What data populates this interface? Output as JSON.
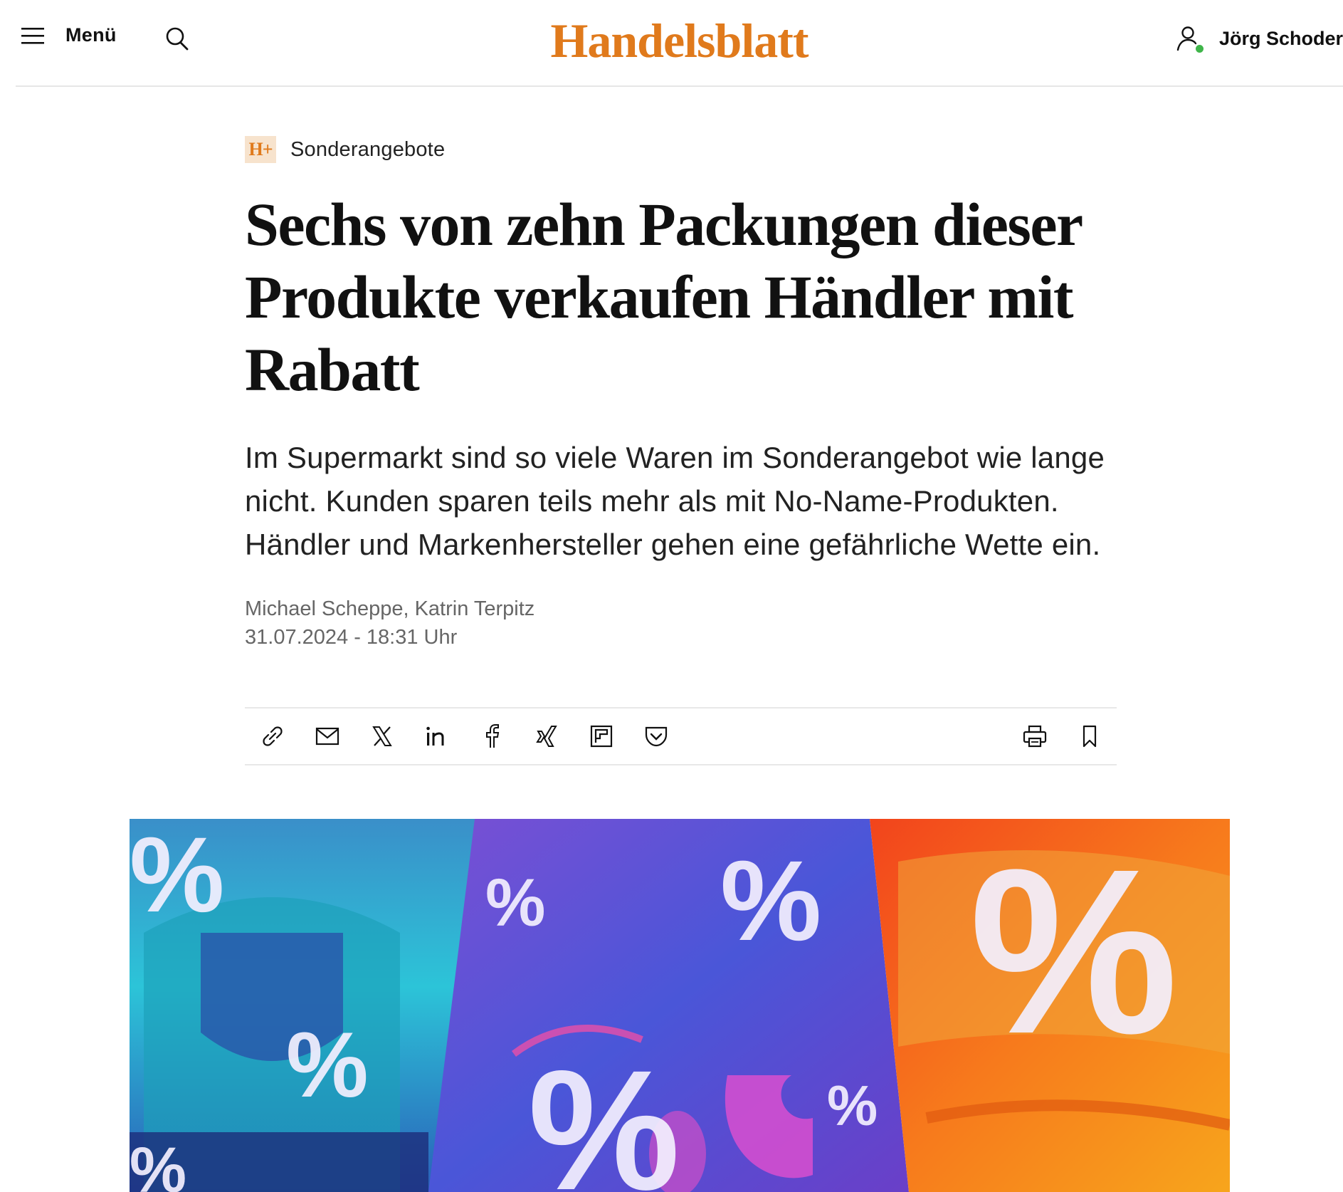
{
  "header": {
    "menu_label": "Menü",
    "logo_text": "Handelsblatt",
    "user_name": "Jörg Schoder",
    "icons": {
      "menu": "hamburger-icon",
      "search": "search-icon",
      "user": "user-icon",
      "status": "online-status-dot"
    }
  },
  "article": {
    "kicker_badge": "H+",
    "kicker": "Sonderangebote",
    "headline": "Sechs von zehn Packungen dieser Produkte verkaufen Händler mit Rabatt",
    "teaser": "Im Supermarkt sind so viele Waren im Sonderangebot wie lange nicht. Kunden sparen teils mehr als mit No-Name-Produkten. Händler und Markenhersteller gehen eine gefährliche Wette ein.",
    "authors": "Michael Scheppe, Katrin Terpitz",
    "date": "31.07.2024 - 18:31 Uhr"
  },
  "share": {
    "left_icons": [
      "link-icon",
      "mail-icon",
      "x-icon",
      "linkedin-icon",
      "facebook-icon",
      "xing-icon",
      "flipboard-icon",
      "pocket-icon"
    ],
    "right_icons": [
      "print-icon",
      "bookmark-icon"
    ]
  },
  "hero": {
    "panel_colors": [
      "#2fc2d6",
      "#5a4bd6",
      "#f26a1b"
    ],
    "symbol": "%"
  },
  "colors": {
    "brand": "#e07a1c",
    "online": "#3fb54a",
    "meta": "#666666"
  }
}
